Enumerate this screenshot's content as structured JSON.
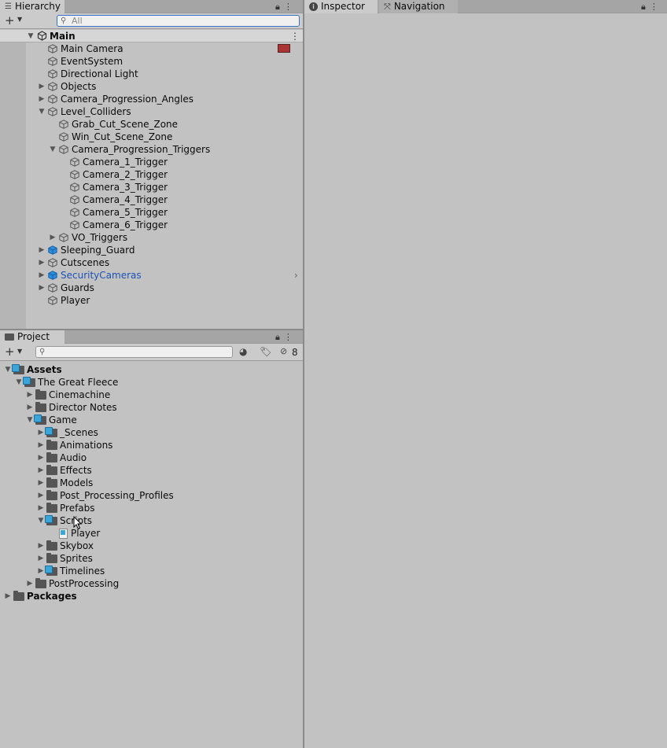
{
  "hierarchy": {
    "tab_label": "Hierarchy",
    "search_placeholder": "All",
    "scene_name": "Main",
    "items": [
      {
        "label": "Main Camera",
        "arrow": ""
      },
      {
        "label": "EventSystem",
        "arrow": ""
      },
      {
        "label": "Directional Light",
        "arrow": ""
      },
      {
        "label": "Objects",
        "arrow": "collapsed"
      },
      {
        "label": "Camera_Progression_Angles",
        "arrow": "collapsed"
      },
      {
        "label": "Level_Colliders",
        "arrow": "expanded"
      },
      {
        "label": "Grab_Cut_Scene_Zone",
        "arrow": ""
      },
      {
        "label": "Win_Cut_Scene_Zone",
        "arrow": ""
      },
      {
        "label": "Camera_Progression_Triggers",
        "arrow": "expanded"
      },
      {
        "label": "Camera_1_Trigger",
        "arrow": ""
      },
      {
        "label": "Camera_2_Trigger",
        "arrow": ""
      },
      {
        "label": "Camera_3_Trigger",
        "arrow": ""
      },
      {
        "label": "Camera_4_Trigger",
        "arrow": ""
      },
      {
        "label": "Camera_5_Trigger",
        "arrow": ""
      },
      {
        "label": "Camera_6_Trigger",
        "arrow": ""
      },
      {
        "label": "VO_Triggers",
        "arrow": "collapsed"
      },
      {
        "label": "Sleeping_Guard",
        "arrow": "collapsed"
      },
      {
        "label": "Cutscenes",
        "arrow": "collapsed"
      },
      {
        "label": "SecurityCameras",
        "arrow": "collapsed"
      },
      {
        "label": "Guards",
        "arrow": "collapsed"
      },
      {
        "label": "Player",
        "arrow": ""
      }
    ]
  },
  "inspector": {
    "tab_label": "Inspector"
  },
  "navigation": {
    "tab_label": "Navigation"
  },
  "project": {
    "tab_label": "Project",
    "hidden_count": "8",
    "items": [
      {
        "label": "Assets"
      },
      {
        "label": "The Great Fleece"
      },
      {
        "label": "Cinemachine"
      },
      {
        "label": "Director Notes"
      },
      {
        "label": "Game"
      },
      {
        "label": "_Scenes"
      },
      {
        "label": "Animations"
      },
      {
        "label": "Audio"
      },
      {
        "label": "Effects"
      },
      {
        "label": "Models"
      },
      {
        "label": "Post_Processing_Profiles"
      },
      {
        "label": "Prefabs"
      },
      {
        "label": "Scripts"
      },
      {
        "label": "Player"
      },
      {
        "label": "Skybox"
      },
      {
        "label": "Sprites"
      },
      {
        "label": "Timelines"
      },
      {
        "label": "PostProcessing"
      },
      {
        "label": "Packages"
      }
    ]
  },
  "colors": {
    "accent_blue": "#1c53b6",
    "panel_bg": "#c2c2c2",
    "tab_bg": "#a5a5a5"
  }
}
